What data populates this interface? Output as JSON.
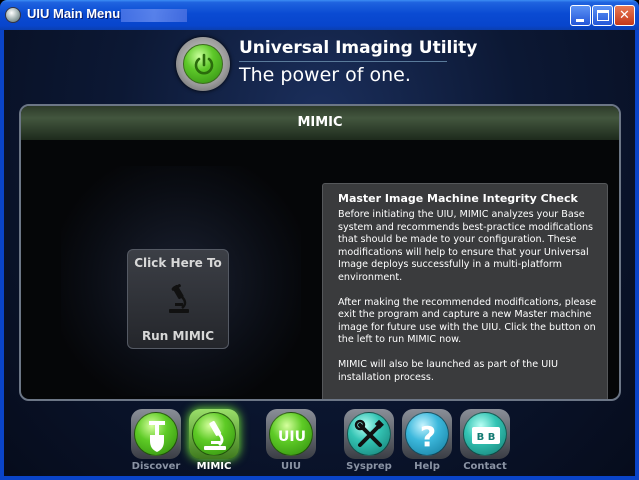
{
  "window": {
    "title": "UIU Main Menu"
  },
  "header": {
    "app_name": "Universal Imaging Utility",
    "tagline": "The power of one."
  },
  "panel": {
    "title": "MIMIC",
    "run_button": {
      "top_label": "Click Here To",
      "bottom_label": "Run MIMIC",
      "icon": "microscope-icon"
    },
    "info": {
      "heading": "Master Image Machine Integrity Check",
      "paragraphs": [
        "Before initiating the UIU, MIMIC analyzes your Base system and recommends best-practice modifications that should be made to your configuration.  These modifications will help to ensure that your Universal Image deploys successfully in a multi-platform environment.",
        "After making the recommended modifications, please exit the program and capture a new Master machine image for future use with the UIU.  Click the button on the left to run MIMIC now.",
        "MIMIC will also be launched as part of the UIU installation process."
      ]
    }
  },
  "toolbar": {
    "items": [
      {
        "label": "Discover",
        "icon": "shovel-icon",
        "color": "green",
        "active": false
      },
      {
        "label": "MIMIC",
        "icon": "microscope-icon",
        "color": "green",
        "active": true
      },
      {
        "label": "UIU",
        "icon": "uiu-logo-icon",
        "color": "green",
        "icon_text": "UIU",
        "active": false
      },
      {
        "label": "Sysprep",
        "icon": "tools-icon",
        "color": "teal",
        "active": false
      },
      {
        "label": "Help",
        "icon": "question-mark-icon",
        "color": "cyan",
        "icon_text": "?",
        "active": false
      },
      {
        "label": "Contact",
        "icon": "contact-card-icon",
        "color": "teal",
        "icon_text": "B B",
        "active": false
      }
    ]
  },
  "colors": {
    "titlebar": "#0845cc",
    "accent_green": "#5ecb26",
    "panel_bg": "#050608",
    "info_bg": "#3a3b3d"
  }
}
